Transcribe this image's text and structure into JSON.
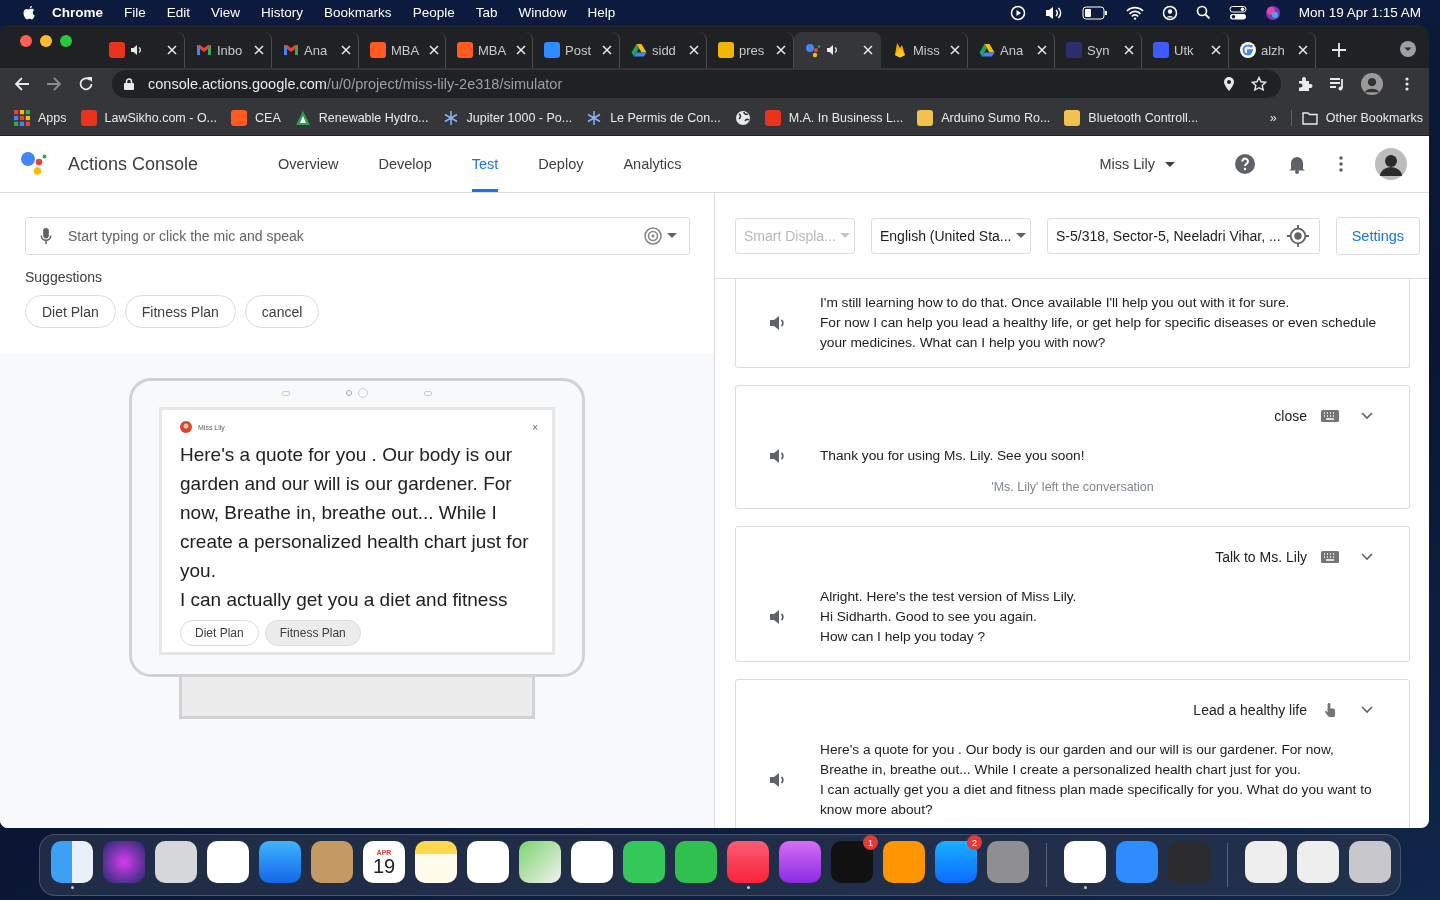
{
  "menu_bar": {
    "app": "Chrome",
    "items": [
      "File",
      "Edit",
      "View",
      "History",
      "Bookmarks",
      "People",
      "Tab",
      "Window",
      "Help"
    ],
    "clock": "Mon 19 Apr  1:15 AM"
  },
  "tabs": [
    {
      "kind": "red",
      "audio": true,
      "selected": false
    },
    {
      "kind": "gmail",
      "label": "Inbo",
      "audio": false,
      "selected": false
    },
    {
      "kind": "gmail",
      "label": "Ana",
      "audio": false,
      "selected": false
    },
    {
      "kind": "orange",
      "label": "MBA",
      "audio": false,
      "selected": false
    },
    {
      "kind": "orange",
      "label": "MBA",
      "audio": false,
      "selected": false
    },
    {
      "kind": "zoom",
      "label": "Post",
      "audio": false,
      "selected": false
    },
    {
      "kind": "drive",
      "label": "sidd",
      "audio": false,
      "selected": false
    },
    {
      "kind": "slides",
      "label": "pres",
      "audio": false,
      "selected": false
    },
    {
      "kind": "assistant",
      "audio": true,
      "selected": true
    },
    {
      "kind": "firebase",
      "label": "Miss",
      "audio": false,
      "selected": false
    },
    {
      "kind": "drive",
      "label": "Ana",
      "audio": false,
      "selected": false
    },
    {
      "kind": "navy",
      "label": "Syn",
      "audio": false,
      "selected": false
    },
    {
      "kind": "blue",
      "label": "Utk",
      "audio": false,
      "selected": false
    },
    {
      "kind": "google",
      "label": "alzh",
      "audio": false,
      "selected": false
    }
  ],
  "address_bar": {
    "host": "console.actions.google.com",
    "path": "/u/0/project/miss-lily-2e318/simulator"
  },
  "bookmarks": [
    {
      "kind": "apps",
      "label": "Apps"
    },
    {
      "kind": "red",
      "label": "LawSikho.com - O..."
    },
    {
      "kind": "orange",
      "label": "CEA"
    },
    {
      "kind": "green",
      "label": "Renewable Hydro..."
    },
    {
      "kind": "snow",
      "label": "Jupiter 1000 - Po..."
    },
    {
      "kind": "snow",
      "label": "Le Permis de Con..."
    },
    {
      "kind": "globe"
    },
    {
      "kind": "red",
      "label": "M.A. In Business L..."
    },
    {
      "kind": "yellow",
      "label": "Arduino Sumo Ro..."
    },
    {
      "kind": "yellow",
      "label": "Bluetooth Controll..."
    }
  ],
  "bookmarks_more": "»",
  "other_bookmarks": "Other Bookmarks",
  "app_header": {
    "title": "Actions Console",
    "nav": [
      {
        "label": "Overview",
        "selected": false
      },
      {
        "label": "Develop",
        "selected": false
      },
      {
        "label": "Test",
        "selected": true
      },
      {
        "label": "Deploy",
        "selected": false
      },
      {
        "label": "Analytics",
        "selected": false
      }
    ],
    "project": "Miss Lily"
  },
  "simulator": {
    "input_placeholder": "Start typing or click the mic and speak",
    "suggestions_label": "Suggestions",
    "suggestions": [
      "Diet Plan",
      "Fitness Plan",
      "cancel"
    ],
    "device": {
      "app_name": "Miss Lily",
      "close": "×",
      "lines": [
        "Here's a quote for you . Our body is our garden and our will is our gardener. For now, Breathe in, breathe out... While I create a personalized health chart just for you.",
        "I can actually get you a diet and fitness"
      ],
      "chips": [
        {
          "label": "Diet Plan",
          "selected": false
        },
        {
          "label": "Fitness Plan",
          "selected": true
        }
      ]
    }
  },
  "controls": {
    "surface": {
      "value": "Smart Displa...",
      "disabled": true
    },
    "language": {
      "value": "English (United Sta...",
      "disabled": false
    },
    "location": "S-5/318, Sector-5, Neeladri Vihar, ...",
    "settings": "Settings"
  },
  "conversation": [
    {
      "lines": [
        "I'm still learning how to do that. Once available I'll help you out with it for sure.",
        "For now I can help you lead a healthy life, or get help for specific diseases or even schedule your medicines. What can I help you with now?"
      ]
    },
    {
      "query": "close",
      "kind": "keyboard",
      "lines": [
        "Thank you for using Ms. Lily. See you soon!"
      ],
      "note": "'Ms. Lily' left the conversation"
    },
    {
      "query": "Talk to Ms. Lily",
      "kind": "keyboard",
      "lines": [
        "Alright. Here's the test version of Miss Lily.",
        "Hi Sidharth. Good to see you again.",
        "How can I help you today ?"
      ]
    },
    {
      "query": "Lead a healthy life",
      "kind": "touch",
      "lines": [
        "Here's a quote for you . Our body is our garden and our will is our gardener. For now, Breathe in, breathe out... While I create a personalized health chart just for you.",
        "I can actually get you a diet and fitness plan made specifically for you. What do you want to know more about?"
      ]
    }
  ],
  "dock": {
    "apps": [
      {
        "kind": "finder",
        "running": true
      },
      {
        "kind": "siri",
        "running": false
      },
      {
        "kind": "launchpad",
        "running": false
      },
      {
        "kind": "safari",
        "running": false
      },
      {
        "kind": "mail",
        "running": false
      },
      {
        "kind": "contacts",
        "running": false
      },
      {
        "kind": "calendar",
        "running": false,
        "month": "APR",
        "day": "19"
      },
      {
        "kind": "notes",
        "running": false
      },
      {
        "kind": "reminders",
        "running": false
      },
      {
        "kind": "maps",
        "running": false
      },
      {
        "kind": "photos",
        "running": false
      },
      {
        "kind": "messages",
        "running": false
      },
      {
        "kind": "facetime",
        "running": false
      },
      {
        "kind": "music",
        "running": true
      },
      {
        "kind": "podcasts",
        "running": false
      },
      {
        "kind": "tv",
        "running": false,
        "badge": "1"
      },
      {
        "kind": "books",
        "running": false
      },
      {
        "kind": "appstore",
        "running": false,
        "badge": "2"
      },
      {
        "kind": "settings",
        "running": false
      },
      {
        "kind": "divider"
      },
      {
        "kind": "chrome",
        "running": true
      },
      {
        "kind": "zoom",
        "running": false
      },
      {
        "kind": "quicktime",
        "running": false
      },
      {
        "kind": "divider"
      },
      {
        "kind": "zip",
        "running": false
      },
      {
        "kind": "pdf",
        "running": false
      },
      {
        "kind": "trash",
        "running": false
      }
    ]
  }
}
